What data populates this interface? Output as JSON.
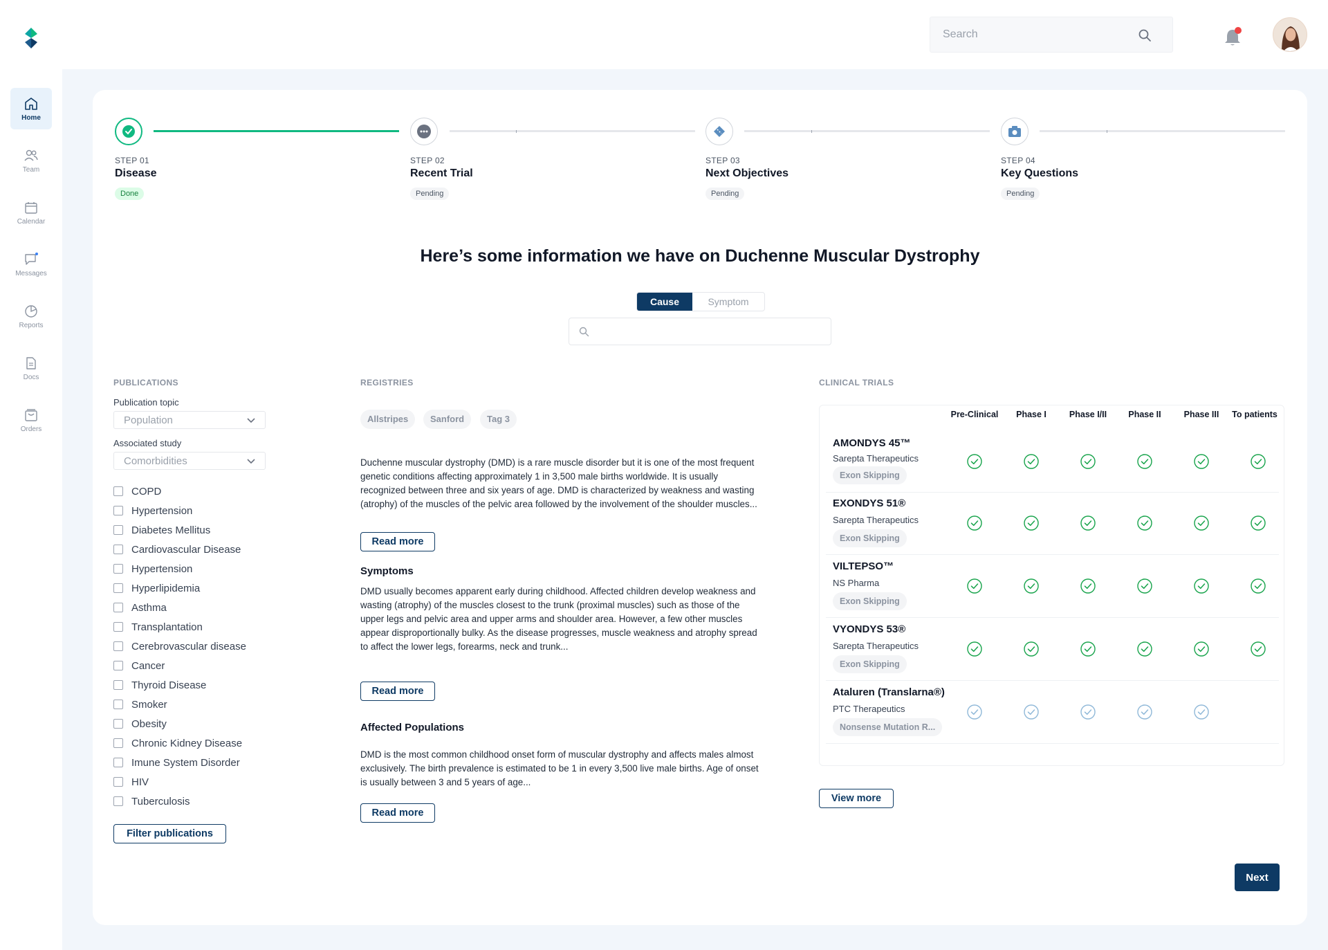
{
  "header": {
    "search_placeholder": "Search",
    "logo_icon": "brand-logo",
    "notification_icon": "bell-icon",
    "has_notification": true
  },
  "sidebar": {
    "items": [
      {
        "label": "Home",
        "icon": "home-icon",
        "active": true
      },
      {
        "label": "Team",
        "icon": "team-icon",
        "active": false
      },
      {
        "label": "Calendar",
        "icon": "calendar-icon",
        "active": false
      },
      {
        "label": "Messages",
        "icon": "messages-icon",
        "active": false
      },
      {
        "label": "Reports",
        "icon": "reports-icon",
        "active": false
      },
      {
        "label": "Docs",
        "icon": "docs-icon",
        "active": false
      },
      {
        "label": "Orders",
        "icon": "orders-icon",
        "active": false
      }
    ]
  },
  "stepper": [
    {
      "step": "STEP 01",
      "title": "Disease",
      "status": "Done"
    },
    {
      "step": "STEP 02",
      "title": "Recent Trial",
      "status": "Pending"
    },
    {
      "step": "STEP 03",
      "title": "Next Objectives",
      "status": "Pending"
    },
    {
      "step": "STEP 04",
      "title": "Key Questions",
      "status": "Pending"
    }
  ],
  "headline": "Here’s some information we have on Duchenne Muscular Dystrophy",
  "segment": {
    "active": "Cause",
    "inactive": "Symptom"
  },
  "publications": {
    "title": "PUBLICATIONS",
    "topic_label": "Publication topic",
    "topic_value": "Population",
    "study_label": "Associated study",
    "study_value": "Comorbidities",
    "conditions": [
      "COPD",
      "Hypertension",
      "Diabetes Mellitus",
      "Cardiovascular Disease",
      "Hypertension",
      "Hyperlipidemia",
      "Asthma",
      "Transplantation",
      "Cerebrovascular disease",
      "Cancer",
      "Thyroid Disease",
      "Smoker",
      "Obesity",
      "Chronic Kidney Disease",
      "Imune System Disorder",
      "HIV",
      "Tuberculosis"
    ],
    "filter_button": "Filter publications"
  },
  "registries": {
    "title": "REGISTRIES",
    "tags": [
      "Allstripes",
      "Sanford",
      "Tag 3"
    ],
    "intro": "Duchenne muscular dystrophy (DMD) is a rare muscle disorder but it is one of the most frequent genetic conditions affecting approximately 1 in 3,500 male births worldwide. It is usually recognized between three and six years of age. DMD is characterized by weakness and wasting (atrophy) of the muscles of the pelvic area followed by the involvement of the shoulder muscles...",
    "symptoms_title": "Symptoms",
    "symptoms": "DMD usually becomes apparent early during childhood. Affected children develop weakness and wasting (atrophy) of the muscles closest to the trunk (proximal muscles) such as those of the upper legs and pelvic area and upper arms and shoulder area. However, a few other muscles appear disproportionally bulky. As the disease progresses, muscle weakness and atrophy spread to affect the lower legs, forearms, neck and trunk...",
    "populations_title": "Affected Populations",
    "populations": "DMD is the most common childhood onset form of muscular dystrophy and affects males almost exclusively. The birth prevalence is estimated to be 1 in every 3,500 live male births. Age of onset is usually between 3 and 5 years of age...",
    "read_more": "Read more"
  },
  "clinical_trials": {
    "title": "CLINICAL TRIALS",
    "phases": [
      "Pre-Clinical",
      "Phase I",
      "Phase I/II",
      "Phase II",
      "Phase III",
      "To patients"
    ],
    "trials": [
      {
        "name": "AMONDYS 45™",
        "company": "Sarepta Therapeutics",
        "tag": "Exon Skipping",
        "completed": 6,
        "faded": false
      },
      {
        "name": "EXONDYS 51®",
        "company": "Sarepta Therapeutics",
        "tag": "Exon Skipping",
        "completed": 6,
        "faded": false
      },
      {
        "name": "VILTEPSO™",
        "company": "NS Pharma",
        "tag": "Exon Skipping",
        "completed": 6,
        "faded": false
      },
      {
        "name": "VYONDYS 53®",
        "company": "Sarepta Therapeutics",
        "tag": "Exon Skipping",
        "completed": 6,
        "faded": false
      },
      {
        "name": "Ataluren (Translarna®)",
        "company": "PTC Therapeutics",
        "tag": "Nonsense Mutation R...",
        "completed": 5,
        "faded": true
      }
    ],
    "view_more": "View more"
  },
  "next_button": "Next",
  "colors": {
    "primary": "#0e3a64",
    "success": "#10b981",
    "check": "#16a34a",
    "check_faded": "#8fb8d8"
  }
}
